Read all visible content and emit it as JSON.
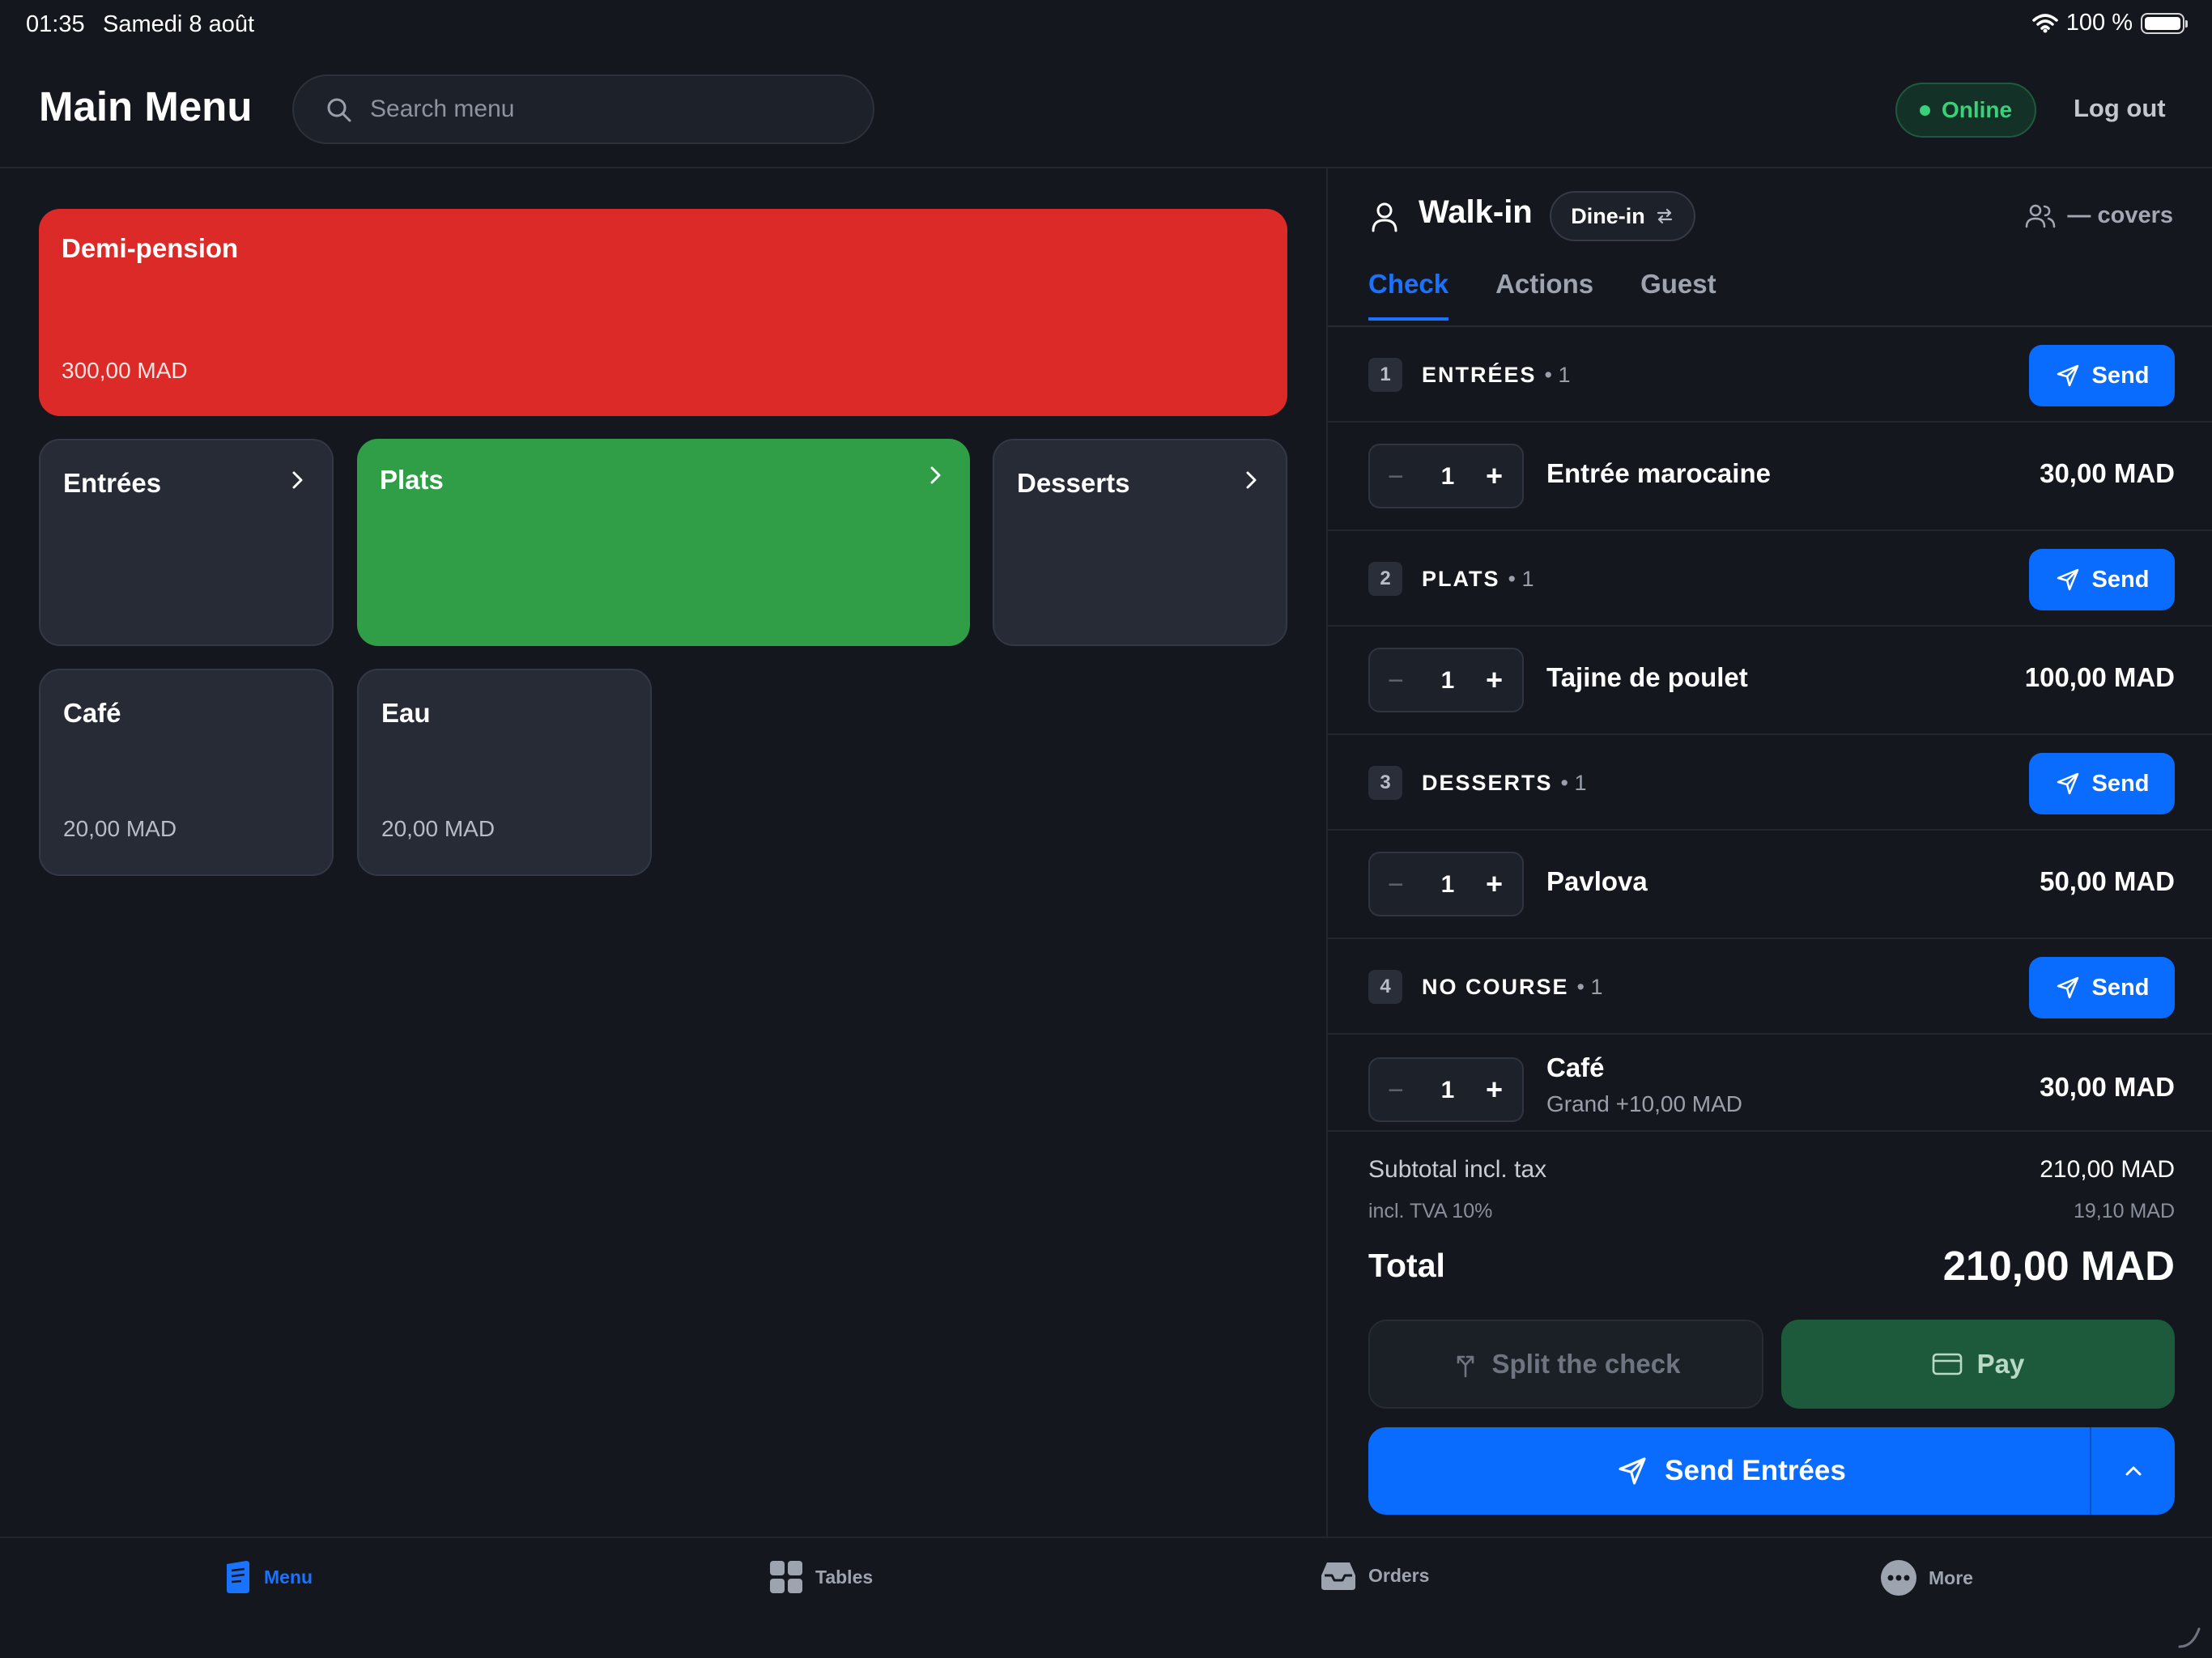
{
  "status_bar": {
    "time": "01:35",
    "date": "Samedi 8 août",
    "battery": "100 %"
  },
  "header": {
    "title": "Main Menu",
    "search_placeholder": "Search menu",
    "status": "Online",
    "logout": "Log out"
  },
  "menu": {
    "featured": {
      "name": "Demi-pension",
      "price": "300,00 MAD",
      "color": "#dc2a28"
    },
    "categories": [
      {
        "name": "Entrées"
      },
      {
        "name": "Plats",
        "color": "#2f9e47"
      },
      {
        "name": "Desserts"
      }
    ],
    "items": [
      {
        "name": "Café",
        "price": "20,00 MAD"
      },
      {
        "name": "Eau",
        "price": "20,00 MAD"
      }
    ]
  },
  "check_panel": {
    "customer": "Walk-in",
    "service_type": "Dine-in",
    "covers": "— covers",
    "tabs": [
      "Check",
      "Actions",
      "Guest"
    ],
    "active_tab": "Check",
    "courses": [
      {
        "num": "1",
        "name": "ENTRÉES",
        "count": "• 1",
        "send": "Send",
        "items": [
          {
            "qty": "1",
            "name": "Entrée marocaine",
            "price": "30,00 MAD"
          }
        ]
      },
      {
        "num": "2",
        "name": "PLATS",
        "count": "• 1",
        "send": "Send",
        "items": [
          {
            "qty": "1",
            "name": "Tajine de poulet",
            "price": "100,00 MAD"
          }
        ]
      },
      {
        "num": "3",
        "name": "DESSERTS",
        "count": "• 1",
        "send": "Send",
        "items": [
          {
            "qty": "1",
            "name": "Pavlova",
            "price": "50,00 MAD"
          }
        ]
      },
      {
        "num": "4",
        "name": "NO COURSE",
        "count": "• 1",
        "send": "Send",
        "items": [
          {
            "qty": "1",
            "name": "Café",
            "modifier": "Grand +10,00 MAD",
            "price": "30,00 MAD"
          }
        ]
      }
    ],
    "subtotal_label": "Subtotal incl. tax",
    "subtotal": "210,00 MAD",
    "tax_label": "incl. TVA 10%",
    "tax": "19,10 MAD",
    "total_label": "Total",
    "total": "210,00 MAD",
    "split_label": "Split the check",
    "pay_label": "Pay",
    "send_main_label": "Send Entrées"
  },
  "bottom_nav": [
    {
      "label": "Menu",
      "icon": "menu-book-icon",
      "active": true
    },
    {
      "label": "Tables",
      "icon": "grid-icon"
    },
    {
      "label": "Orders",
      "icon": "inbox-tray-icon"
    },
    {
      "label": "More",
      "icon": "more-dots-icon"
    }
  ],
  "colors": {
    "accent": "#0a6cff",
    "online": "#3bd07a",
    "pay": "#1d5a3b",
    "background": "#14171d"
  }
}
